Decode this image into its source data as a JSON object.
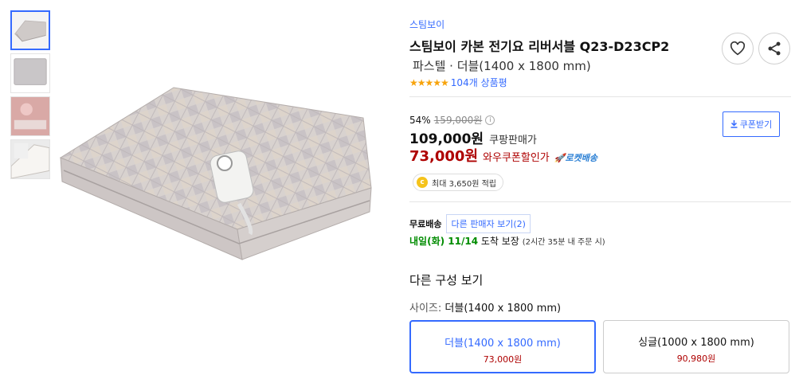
{
  "thumbnails": [
    {
      "name": "thumb-blanket-folded"
    },
    {
      "name": "thumb-fabric-pattern"
    },
    {
      "name": "thumb-bedroom-scene"
    },
    {
      "name": "thumb-blanket-closeup"
    }
  ],
  "product": {
    "brand": "스팀보이",
    "title": "스팀보이 카본 전기요 리버서블 Q23-D23CP2",
    "subtitle": "파스텔 · 더블(1400 x 1800 mm)",
    "stars": "★★★★★",
    "review_count": "104개 상품평"
  },
  "pricing": {
    "discount": "54%",
    "original_price": "159,000원",
    "info_icon": "i",
    "sale_price": "109,000원",
    "sale_label": "쿠팡판매가",
    "coupon_price": "73,000원",
    "coupon_label": "와우쿠폰할인가",
    "rocket_label": "🚀로켓배송",
    "coupon_button": "쿠폰받기",
    "points_coin": "c",
    "points": "최대 3,650원 적립"
  },
  "shipping": {
    "label": "무료배송",
    "other_seller": "다른 판매자 보기(2)",
    "arrival": "내일(화) 11/14",
    "arrival_suffix": " 도착 보장",
    "note": "(2시간 35분 내 주문 시)"
  },
  "options": {
    "title": "다른 구성 보기",
    "size_label": "사이즈:",
    "size_value": "더블(1400 x 1800 mm)",
    "items": [
      {
        "name": "더블(1400 x 1800 mm)",
        "price": "73,000원",
        "selected": true
      },
      {
        "name": "싱글(1000 x 1800 mm)",
        "price": "90,980원",
        "selected": false
      }
    ]
  },
  "colors": {
    "accent": "#346aff",
    "price_red": "#ae0000",
    "star": "#f7a30b",
    "green": "#008c00"
  }
}
